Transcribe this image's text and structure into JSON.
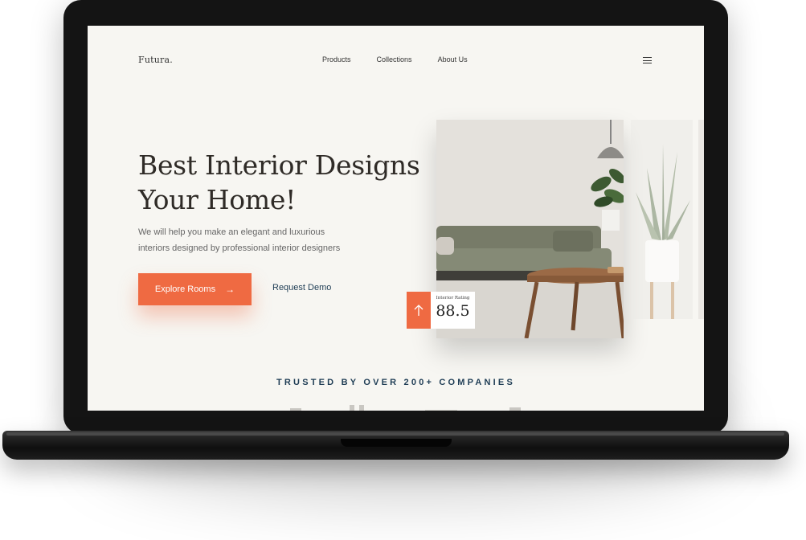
{
  "site": {
    "logo": "Futura."
  },
  "nav": {
    "items": [
      {
        "label": "Products"
      },
      {
        "label": "Collections"
      },
      {
        "label": "About Us"
      }
    ]
  },
  "hero": {
    "title_line1": "Best Interior Designs",
    "title_line2": "Your Home!",
    "subtitle_line1": "We will help you make an elegant and luxurious",
    "subtitle_line2": "interiors designed by professional interior designers",
    "primary_cta": "Explore Rooms",
    "secondary_cta": "Request Demo"
  },
  "rating": {
    "label": "Interior Rating",
    "value": "88.5"
  },
  "trusted": {
    "text": "TRUSTED BY OVER 200+ COMPANIES"
  },
  "colors": {
    "accent": "#ef6a42",
    "navy": "#1f3d55",
    "background": "#f7f6f2"
  },
  "icons": [
    "menu-icon",
    "arrow-right-icon",
    "arrow-up-icon"
  ]
}
